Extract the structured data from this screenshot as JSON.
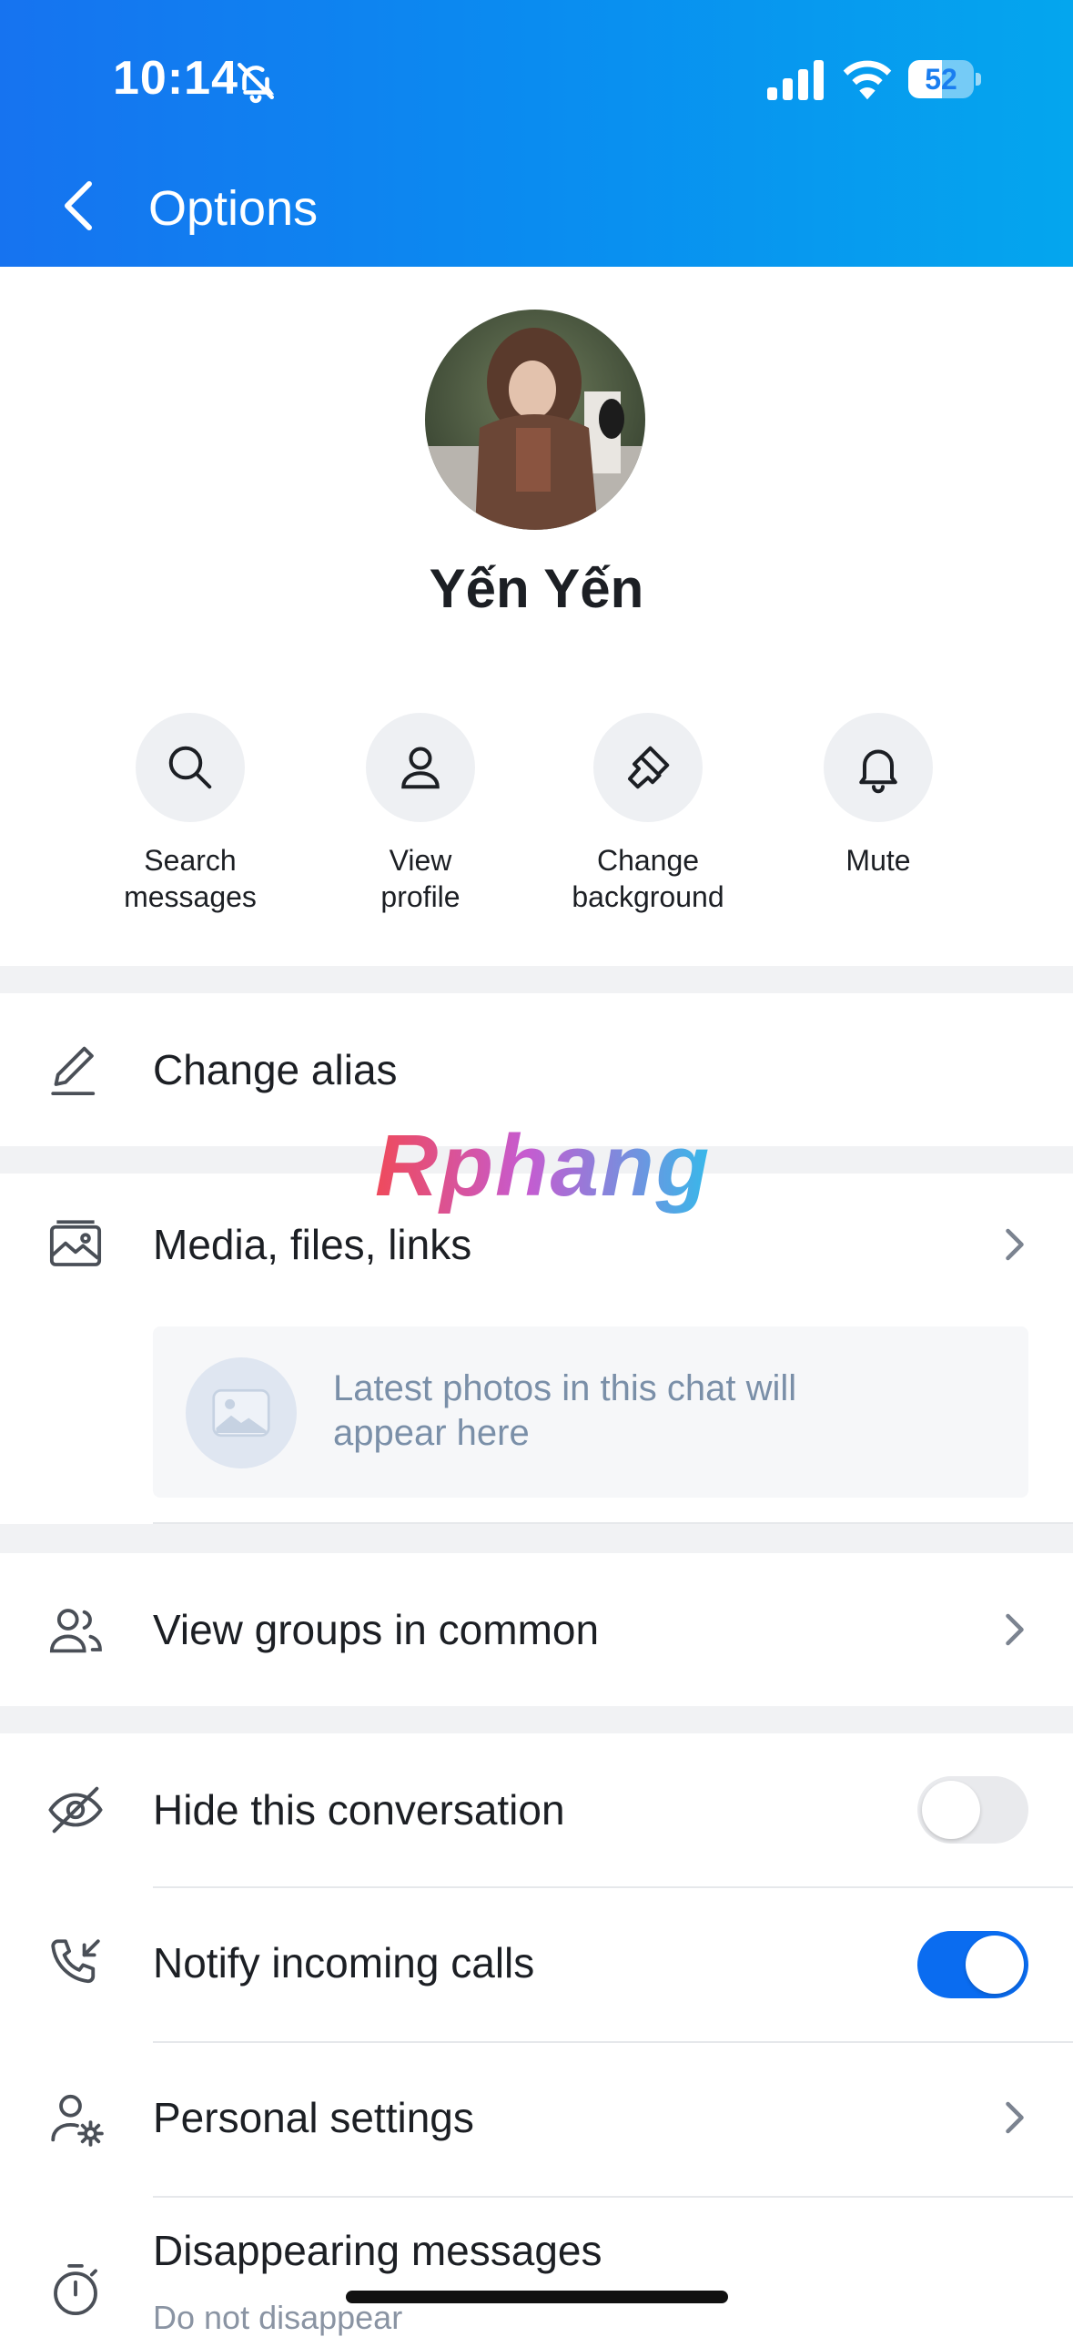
{
  "status_bar": {
    "time": "10:14",
    "battery": "52",
    "battery_level": 0.52
  },
  "header": {
    "title": "Options"
  },
  "profile": {
    "name": "Yến Yến"
  },
  "actions": [
    {
      "label": "Search\nmessages",
      "icon": "search-icon"
    },
    {
      "label": "View\nprofile",
      "icon": "person-icon"
    },
    {
      "label": "Change\nbackground",
      "icon": "paintbrush-icon"
    },
    {
      "label": "Mute",
      "icon": "bell-icon"
    }
  ],
  "rows": {
    "change_alias": {
      "label": "Change alias",
      "icon": "pencil-icon"
    },
    "media": {
      "label": "Media, files, links",
      "icon": "gallery-icon",
      "placeholder": "Latest photos in this chat will appear here"
    },
    "groups": {
      "label": "View groups in common",
      "icon": "group-icon"
    },
    "hide": {
      "label": "Hide this conversation",
      "icon": "eye-off-icon",
      "on": false
    },
    "notify_calls": {
      "label": "Notify incoming calls",
      "icon": "phone-incoming-icon",
      "on": true
    },
    "personal": {
      "label": "Personal settings",
      "icon": "user-gear-icon"
    },
    "disappearing": {
      "label": "Disappearing messages",
      "sublabel": "Do not disappear",
      "icon": "timer-icon"
    }
  },
  "watermark": "Rphang",
  "colors": {
    "header_start": "#1673f0",
    "header_end": "#04a6ee",
    "toggle_on": "#0a6cf0",
    "accent_text": "#7a8fa8"
  }
}
